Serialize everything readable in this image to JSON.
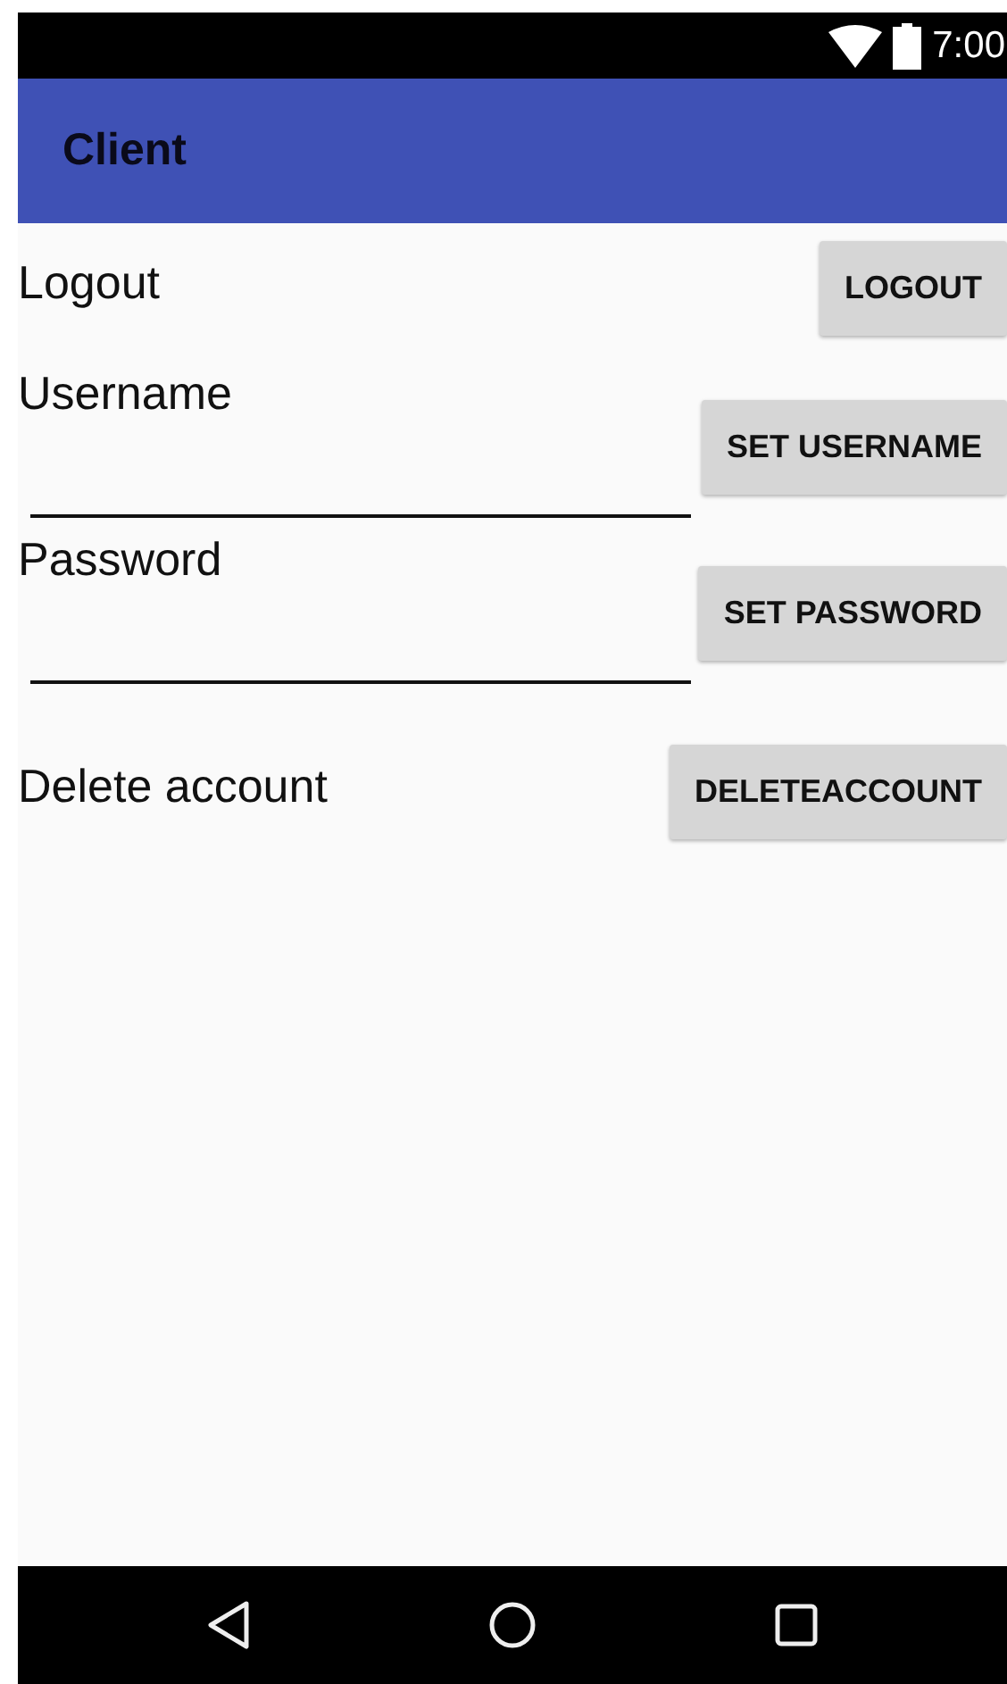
{
  "status_bar": {
    "time": "7:00"
  },
  "app_bar": {
    "title": "Client"
  },
  "rows": [
    {
      "kind": "action",
      "label": "Logout",
      "button": "LOGOUT"
    },
    {
      "kind": "field",
      "label": "Username",
      "button": "SET USERNAME"
    },
    {
      "kind": "field",
      "label": "Password",
      "button": "SET PASSWORD"
    },
    {
      "kind": "action",
      "label": "Delete account",
      "button": "DELETEACCOUNT"
    }
  ]
}
